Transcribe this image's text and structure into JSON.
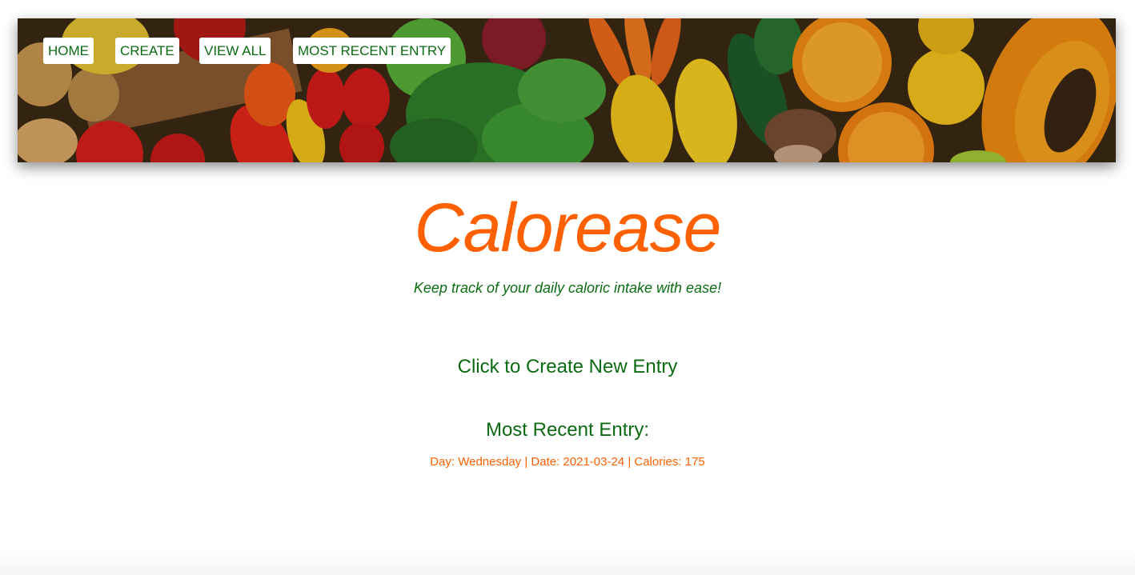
{
  "nav": {
    "items": [
      {
        "label": "HOME"
      },
      {
        "label": "CREATE"
      },
      {
        "label": "VIEW ALL"
      },
      {
        "label": "MOST RECENT ENTRY"
      }
    ]
  },
  "hero": {
    "title": "Calorease",
    "tagline": "Keep track of your daily caloric intake with ease!"
  },
  "main": {
    "create_link": "Click to Create New Entry",
    "recent_heading": "Most Recent Entry:",
    "recent_entry": "Day: Wednesday | Date: 2021-03-24 | Calories: 175"
  },
  "colors": {
    "accent_orange": "#ff6000",
    "brand_green": "#0b6b12"
  }
}
